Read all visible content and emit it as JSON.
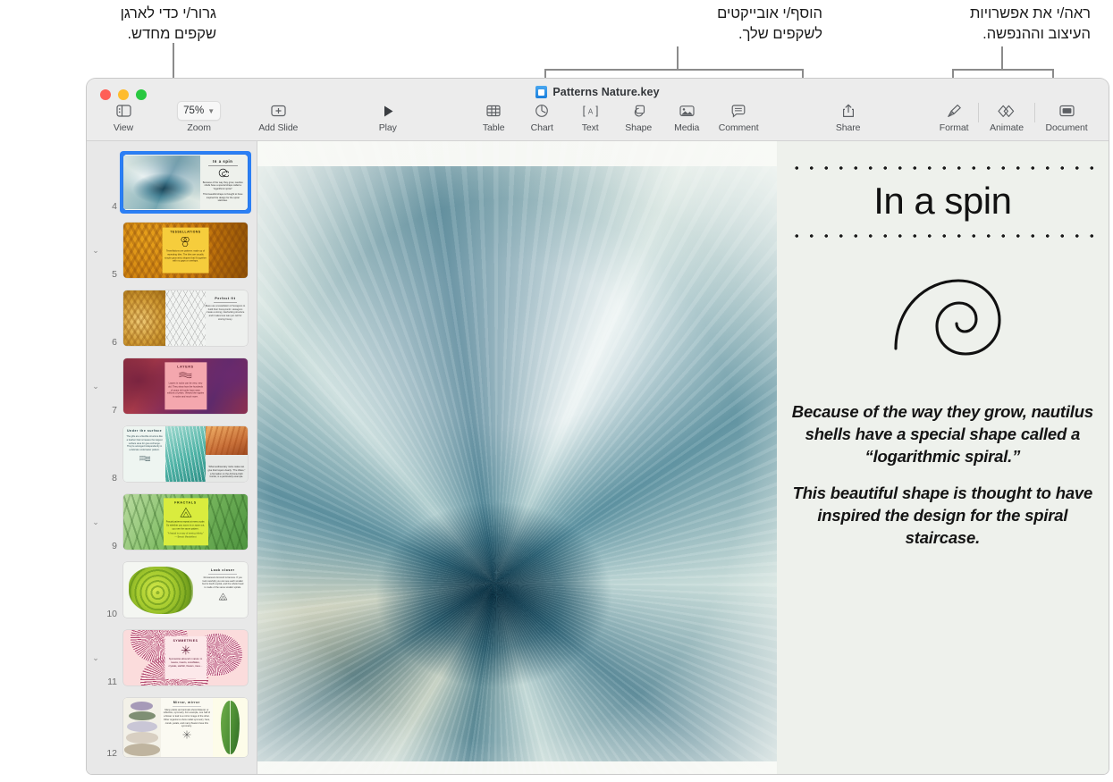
{
  "annotations": [
    {
      "id": "drag-reorder",
      "text": "גרור/י כדי לארגן\nשקפים מחדש."
    },
    {
      "id": "insert-objects",
      "text": "הוסף/י אובייקטים\nלשקפים שלך."
    },
    {
      "id": "design-options",
      "text": "ראה/י את אפשרויות\nהעיצוב וההנפשה."
    }
  ],
  "window": {
    "title": "Patterns Nature.key",
    "doc_icon": "keynote-document-icon",
    "traffic_lights": [
      {
        "name": "close",
        "color": "#ff5f57"
      },
      {
        "name": "minimize",
        "color": "#febc2e"
      },
      {
        "name": "zoom",
        "color": "#28c840"
      }
    ]
  },
  "toolbar": {
    "items": [
      {
        "id": "view",
        "label": "View",
        "icon": "sidebar-icon"
      },
      {
        "id": "zoom",
        "label": "Zoom",
        "icon": "chevron-down-icon",
        "value": "75%"
      },
      {
        "id": "add-slide",
        "label": "Add Slide",
        "icon": "plus-box-icon"
      },
      {
        "id": "play",
        "label": "Play",
        "icon": "play-triangle-icon"
      },
      {
        "id": "table",
        "label": "Table",
        "icon": "table-grid-icon"
      },
      {
        "id": "chart",
        "label": "Chart",
        "icon": "pie-chart-icon"
      },
      {
        "id": "text",
        "label": "Text",
        "icon": "text-box-icon"
      },
      {
        "id": "shape",
        "label": "Shape",
        "icon": "shapes-icon"
      },
      {
        "id": "media",
        "label": "Media",
        "icon": "photo-icon"
      },
      {
        "id": "comment",
        "label": "Comment",
        "icon": "comment-bubble-icon"
      },
      {
        "id": "share",
        "label": "Share",
        "icon": "share-upload-icon"
      },
      {
        "id": "format",
        "label": "Format",
        "icon": "paintbrush-icon"
      },
      {
        "id": "animate",
        "label": "Animate",
        "icon": "animate-diamonds-icon"
      },
      {
        "id": "document",
        "label": "Document",
        "icon": "document-panel-icon"
      }
    ]
  },
  "navigator": {
    "selected_slide": 4,
    "accent": "#2b7ff5",
    "slides": [
      {
        "number": "4",
        "name": "in-a-spin",
        "title": "In a spin",
        "has_disclosure": false,
        "selected": true
      },
      {
        "number": "5",
        "name": "tessellations",
        "title": "TESSELLATIONS",
        "has_disclosure": true,
        "selected": false
      },
      {
        "number": "6",
        "name": "perfect-fit",
        "title": "Perfect fit",
        "has_disclosure": false,
        "selected": false
      },
      {
        "number": "7",
        "name": "layers",
        "title": "LAYERS",
        "has_disclosure": true,
        "selected": false
      },
      {
        "number": "8",
        "name": "under-the-surface",
        "title": "Under the surface",
        "has_disclosure": false,
        "selected": false
      },
      {
        "number": "9",
        "name": "fractals",
        "title": "FRACTALS",
        "has_disclosure": true,
        "selected": false
      },
      {
        "number": "10",
        "name": "look-closer",
        "title": "Look closer",
        "has_disclosure": false,
        "selected": false
      },
      {
        "number": "11",
        "name": "symmetries",
        "title": "SYMMETRIES",
        "has_disclosure": true,
        "selected": false
      },
      {
        "number": "12",
        "name": "mirror-mirror",
        "title": "Mirror, mirror",
        "has_disclosure": false,
        "selected": false
      }
    ]
  },
  "slide": {
    "background": "#eef1ec",
    "photo_alt": "nautilus-shell-photo",
    "heading": "In a spin",
    "graphic": "logarithmic-spiral",
    "paragraphs": [
      "Because of the way they grow, nautilus shells have a special shape called a “logarithmic spiral.”",
      "This beautiful shape is thought to have inspired the design for the spiral staircase."
    ]
  }
}
